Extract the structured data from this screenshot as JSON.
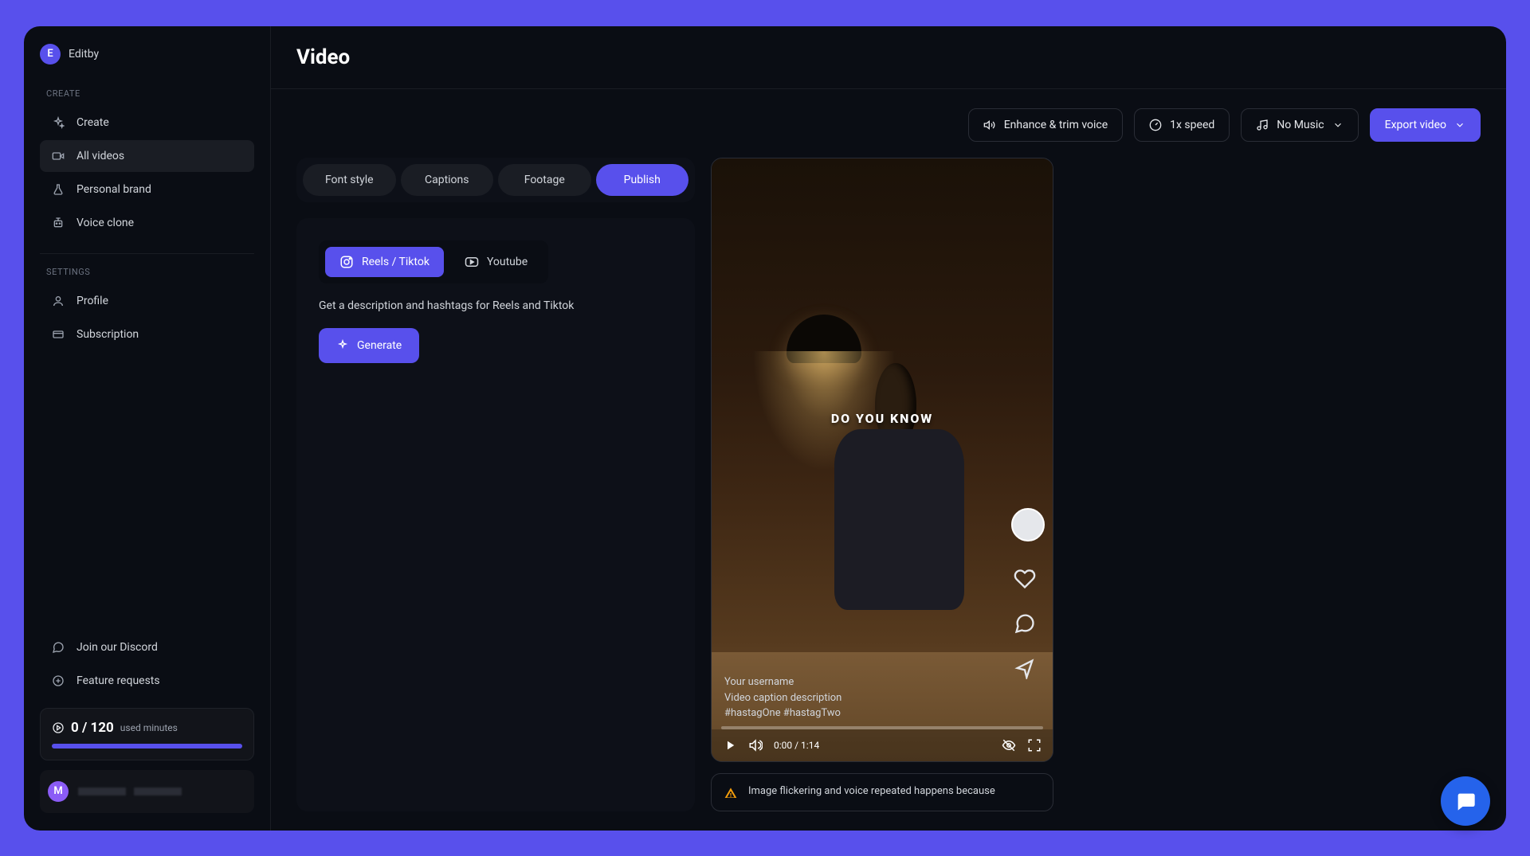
{
  "workspace": {
    "initial": "E",
    "name": "Editby"
  },
  "sections": {
    "create_label": "CREATE",
    "settings_label": "SETTINGS"
  },
  "nav": {
    "create": "Create",
    "all_videos": "All videos",
    "personal_brand": "Personal brand",
    "voice_clone": "Voice clone",
    "profile": "Profile",
    "subscription": "Subscription",
    "discord": "Join our Discord",
    "feature_requests": "Feature requests"
  },
  "usage": {
    "count": "0 / 120",
    "suffix": "used minutes"
  },
  "user": {
    "initial": "M"
  },
  "page": {
    "title": "Video"
  },
  "toolbar": {
    "enhance": "Enhance & trim voice",
    "speed": "1x speed",
    "music": "No Music",
    "export": "Export video"
  },
  "tabs": {
    "font_style": "Font style",
    "captions": "Captions",
    "footage": "Footage",
    "publish": "Publish"
  },
  "publish_panel": {
    "reels": "Reels / Tiktok",
    "youtube": "Youtube",
    "instruction": "Get a description and hashtags for Reels and Tiktok",
    "generate": "Generate"
  },
  "preview": {
    "caption": "DO YOU KNOW",
    "username": "Your username",
    "description": "Video caption description",
    "hashtags": "#hastagOne #hastagTwo",
    "time": "0:00 / 1:14"
  },
  "warning": {
    "text": "Image flickering and voice repeated happens because"
  }
}
